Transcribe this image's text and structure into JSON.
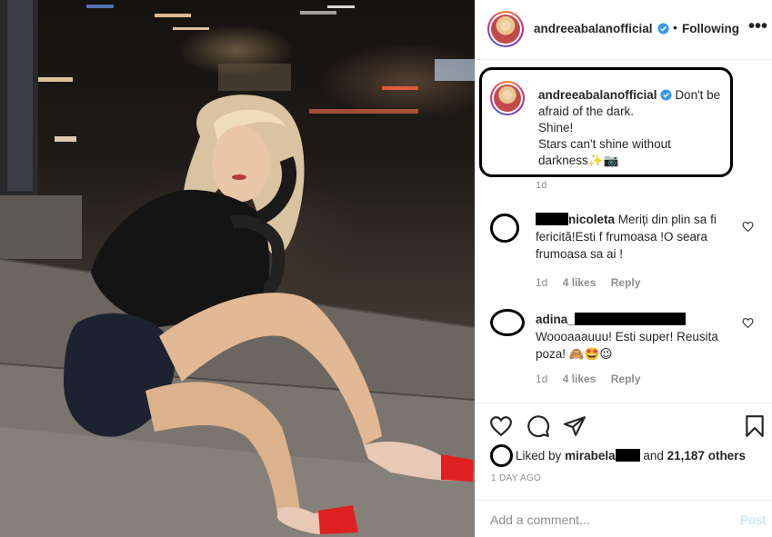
{
  "post": {
    "author": "andreeabalanofficial",
    "follow_label": "Following",
    "more_label": "•••",
    "separator": "•",
    "caption_lines": [
      "Don't be",
      "afraid of the dark.",
      "Shine!",
      "Stars can't shine without",
      "darkness✨📷"
    ],
    "caption_time": "1d"
  },
  "comments": [
    {
      "username_visible": "nicoleta",
      "text_first": "Meriți din plin sa fi",
      "text_rest": [
        "fericită!Esti f frumoasa !O seara",
        "frumoasa sa ai !"
      ],
      "time": "1d",
      "likes": "4 likes",
      "reply": "Reply"
    },
    {
      "username_visible": "adina_",
      "text_lines": [
        "Woooaaauuu! Esti super! Reusita",
        "poza! 🙈🤩😉"
      ],
      "time": "1d",
      "likes": "4 likes",
      "reply": "Reply"
    }
  ],
  "likes": {
    "prefix": "Liked by",
    "user_visible": "mirabela",
    "middle": "and",
    "count": "21,187 others"
  },
  "time_ago": "1 DAY AGO",
  "add_comment": {
    "placeholder": "Add a comment...",
    "post_label": "Post"
  },
  "icons": {
    "header_more": "more-icon",
    "verified": "verified-badge-icon",
    "like": "heart-icon",
    "comment": "comment-icon",
    "share": "share-icon",
    "save": "bookmark-icon"
  },
  "colors": {
    "verified": "#3897f0",
    "text": "#262626",
    "muted": "#8e8e8e",
    "post_disabled": "#b2dffc",
    "annotation": "#000000"
  }
}
